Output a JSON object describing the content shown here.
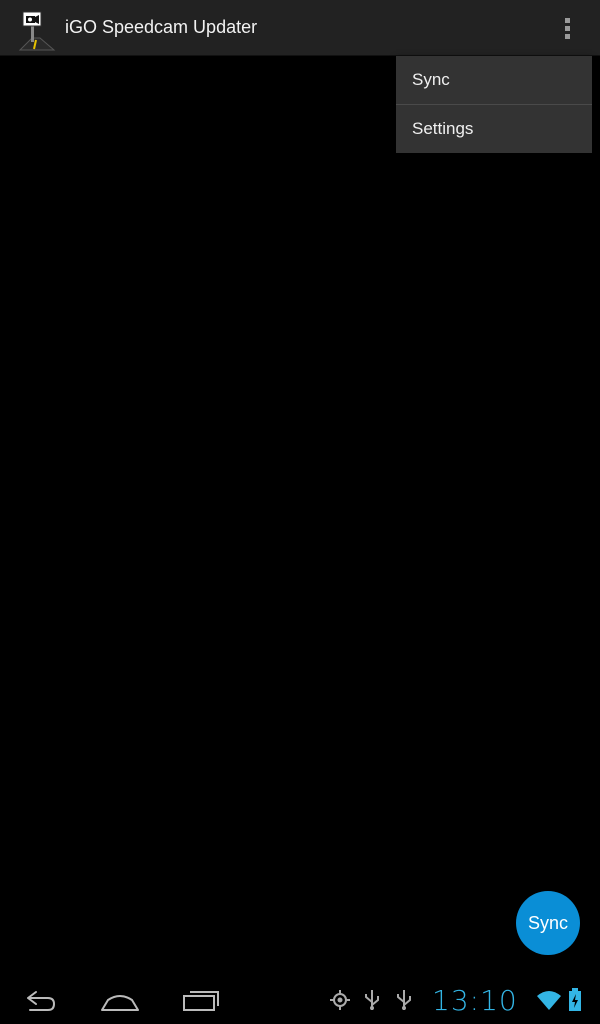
{
  "app": {
    "title": "iGO Speedcam Updater",
    "icon": "speedcam-road-icon"
  },
  "action_bar": {
    "overflow_icon": "overflow-menu-icon"
  },
  "overflow_menu": {
    "items": [
      {
        "label": "Sync"
      },
      {
        "label": "Settings"
      }
    ]
  },
  "fab": {
    "label": "Sync",
    "color": "#0a8ed6"
  },
  "system_bar": {
    "clock": "13:10",
    "accent_color": "#33b5e5",
    "nav_icons": [
      "back-icon",
      "home-icon",
      "recent-apps-icon"
    ],
    "status_icons": [
      "gps-icon",
      "usb-icon",
      "usb-icon",
      "wifi-icon",
      "battery-charging-icon"
    ]
  },
  "colors": {
    "action_bar_bg": "#222222",
    "menu_bg": "#333333",
    "background": "#000000"
  }
}
